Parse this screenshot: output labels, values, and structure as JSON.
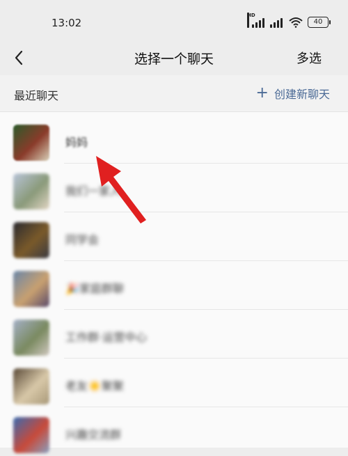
{
  "status_bar": {
    "time": "13:02",
    "battery": "40",
    "hd": "HD"
  },
  "header": {
    "title": "选择一个聊天",
    "multi_select": "多选"
  },
  "section": {
    "label": "最近聊天",
    "create_label": "创建新聊天"
  },
  "chats": [
    {
      "name": "妈妈",
      "avatar_colors": [
        "#2c5a2a",
        "#8a3b2a",
        "#d8d0b8"
      ]
    },
    {
      "name": "我们一家人",
      "avatar_colors": [
        "#b8c4d8",
        "#8a9a7a",
        "#e2d6c4"
      ]
    },
    {
      "name": "同学会",
      "avatar_colors": [
        "#2a2a30",
        "#7a5a2a",
        "#3a3a42"
      ]
    },
    {
      "name": "🎉家庭群聊",
      "avatar_colors": [
        "#6a86a8",
        "#c8a070",
        "#5a4a6a"
      ]
    },
    {
      "name": "工作群·运营中心",
      "avatar_colors": [
        "#a4b0c8",
        "#7a8a60",
        "#d0c8c0"
      ]
    },
    {
      "name": "老友☀️聚聚",
      "avatar_colors": [
        "#5a4a38",
        "#d8c8a8",
        "#a89878"
      ]
    },
    {
      "name": "兴趣交流群",
      "avatar_colors": [
        "#3a6ab0",
        "#c84a3a",
        "#88a0c0"
      ]
    }
  ],
  "colors": {
    "accent": "#4b6a96",
    "arrow": "#e02020",
    "background": "#ededed"
  }
}
